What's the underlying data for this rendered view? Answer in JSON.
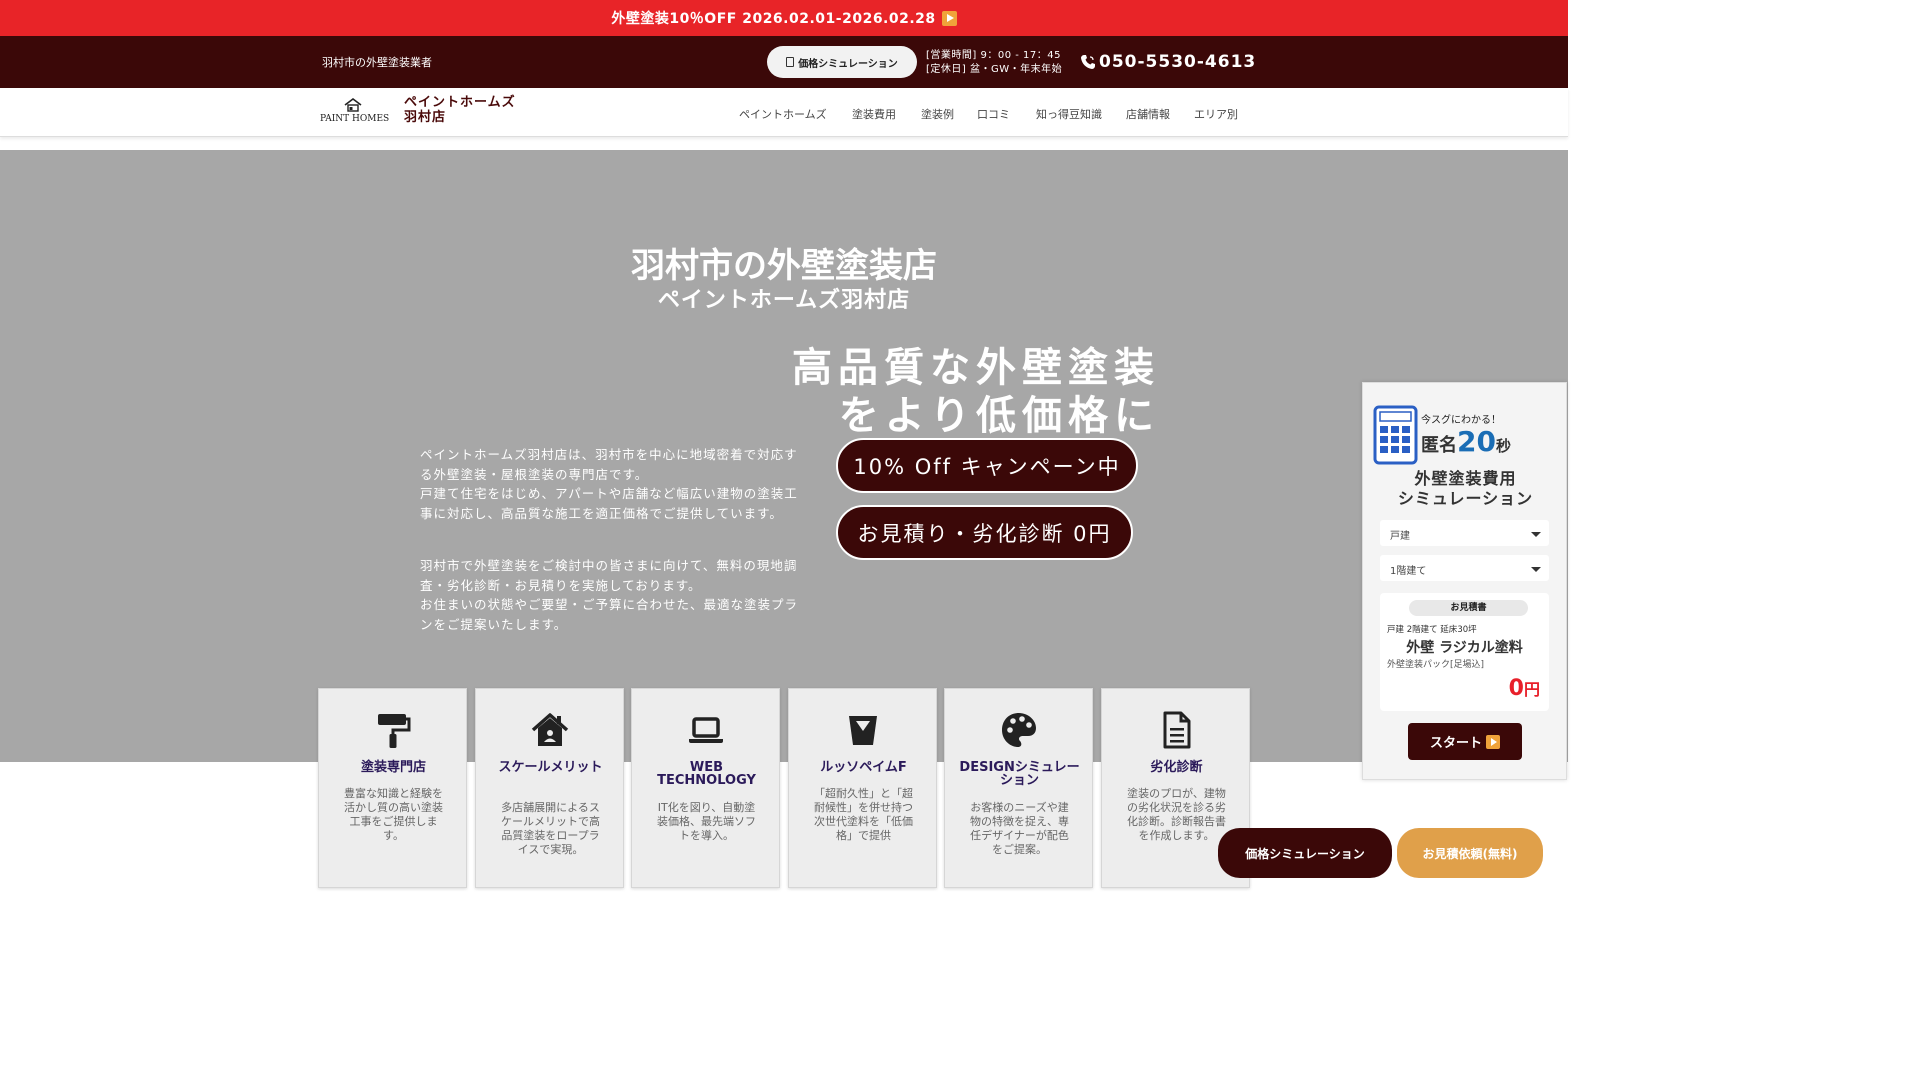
{
  "topbar": {
    "text": "外壁塗装10％OFF 2026.02.01-2026.02.28"
  },
  "infobar": {
    "tagline": "羽村市の外壁塗装業者",
    "sim_button": "価格シミュレーション",
    "hours_line1": "[営業時間] 9：00 - 17：45",
    "hours_line2": "[定休日] 盆・GW・年末年始",
    "phone": "050-5530-4613"
  },
  "header": {
    "logo_text": "PAINT HOMES",
    "brand_line1": "ペイントホームズ",
    "brand_line2": "羽村店",
    "menu": [
      "ペイントホームズ",
      "塗装費用",
      "塗装例",
      "口コミ",
      "知っ得豆知識",
      "店舗情報",
      "エリア別"
    ]
  },
  "hero": {
    "title": "羽村市の外壁塗装店",
    "subtitle": "ペイントホームズ羽村店",
    "catch_line1": "高品質な外壁塗装",
    "catch_line2": "をより低価格に",
    "desc1": "ペイントホームズ羽村店は、羽村市を中心に地域密着で対応する外壁塗装・屋根塗装の専門店です。\n戸建て住宅をはじめ、アパートや店舗など幅広い建物の塗装工事に対応し、高品質な施工を適正価格でご提供しています。",
    "desc2": "羽村市で外壁塗装をご検討中の皆さまに向けて、無料の現地調査・劣化診断・お見積りを実施しております。\nお住まいの状態やご要望・ご予算に合わせた、最適な塗装プランをご提案いたします。",
    "badge1": "10% Off キャンペーン中",
    "badge2": "お見積り・劣化診断 0円"
  },
  "cards": [
    {
      "title": "塗装専門店",
      "desc": "豊富な知識と経験を活かし質の高い塗装工事をご提供します。",
      "icon": "paint-roller-icon"
    },
    {
      "title": "スケールメリット",
      "desc": "多店舗展開によるスケールメリットで高品質塗装をロープライスで実現。",
      "icon": "house-icon"
    },
    {
      "title": "WEB TECHNOLOGY",
      "desc": "IT化を図り、自動塗装価格、最先端ソフトを導入。",
      "icon": "laptop-icon"
    },
    {
      "title": "ルッソペイムF",
      "desc": "「超耐久性」と「超耐候性」を併せ持つ次世代塗料を「低価格」で提供",
      "icon": "paint-bucket-icon"
    },
    {
      "title": "DESIGNシミュレーション",
      "desc": "お客様のニーズや建物の特徴を捉え、専任デザイナーが配色をご提案。",
      "icon": "palette-icon"
    },
    {
      "title": "劣化診断",
      "desc": "塗装のプロが、建物の劣化状況を診る劣化診断。診断報告書を作成します。",
      "icon": "document-icon"
    }
  ],
  "widget": {
    "now": "今スグにわかる！",
    "anon": "匿名",
    "seconds_num": "20",
    "seconds_unit": "秒",
    "title_line1": "外壁塗装費用",
    "title_line2": "シミュレーション",
    "select1": "戸建",
    "select2": "1階建て",
    "estimate_badge": "お見積書",
    "estimate_line1": "戸建 2階建て 延床30坪",
    "estimate_line2": "外壁 ラジカル塗料",
    "estimate_line3": "外壁塗装パック[足場込]",
    "price": "0",
    "price_unit": "円",
    "start": "スタート"
  },
  "floating": {
    "sim": "価格シミュレーション",
    "quote": "お見積依頼(無料)"
  },
  "colors": {
    "red": "#e82428",
    "maroon": "#3b0808",
    "hero_gray": "#a7a7a7",
    "orange": "#e0a04a",
    "blue": "#1a6db5"
  }
}
